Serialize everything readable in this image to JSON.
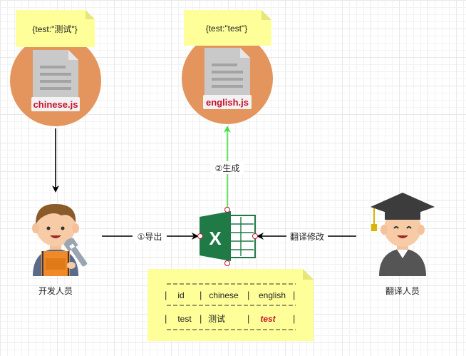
{
  "notes": {
    "chinese_note": "{test:\"测试\"}",
    "english_note": "{test:\"test\"}"
  },
  "files": {
    "chinese_file": "chinese.js",
    "english_file": "english.js"
  },
  "edges": {
    "export_label": "①导出",
    "generate_label": "②生成",
    "translate_label": "翻译修改"
  },
  "people": {
    "developer": "开发人员",
    "translator": "翻译人员"
  },
  "table": {
    "headers": [
      "id",
      "chinese",
      "english"
    ],
    "row": [
      "test",
      "测试",
      "test"
    ]
  },
  "colors": {
    "circle": "#e4955e",
    "note": "#ffff99",
    "accent_red": "#c8102e",
    "green_arrow": "#44dd44",
    "excel_green": "#1f7a46"
  }
}
